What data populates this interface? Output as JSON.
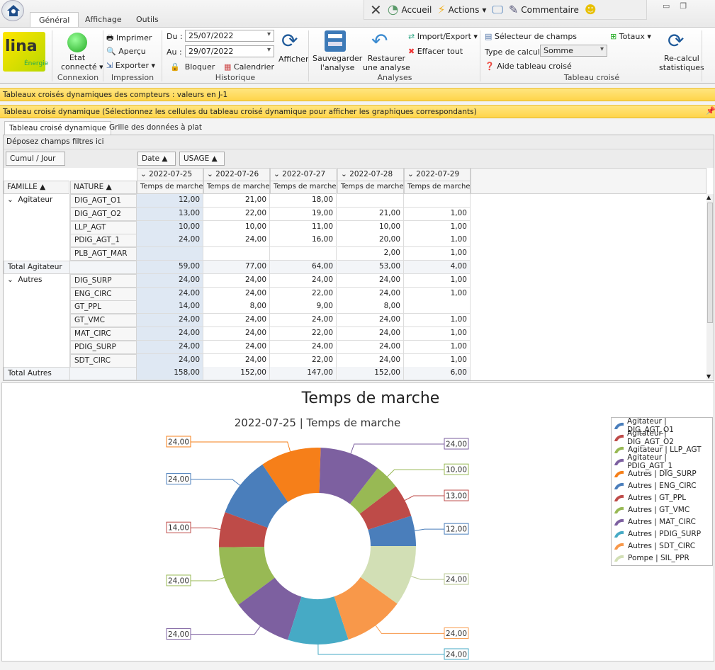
{
  "ribbon_tabs": [
    "Général",
    "Affichage",
    "Outils"
  ],
  "quick": {
    "accueil": "Accueil",
    "actions": "Actions",
    "commentaire": "Commentaire"
  },
  "logo": {
    "text": "lina",
    "sub": "Énergie"
  },
  "connexion": {
    "etat": "Etat",
    "connecte": "connecté ▾",
    "label": "Connexion"
  },
  "impression": {
    "imprimer": "Imprimer",
    "apercu": "Aperçu",
    "exporter": "Exporter ▾",
    "label": "Impression"
  },
  "historique": {
    "du_label": "Du :",
    "du": "25/07/2022",
    "au_label": "Au :",
    "au": "29/07/2022",
    "bloquer": "Bloquer",
    "calendrier": "Calendrier",
    "afficher": "Afficher",
    "label": "Historique"
  },
  "analyses": {
    "sauver1": "Sauvegarder",
    "sauver2": "l'analyse",
    "rest1": "Restaurer",
    "rest2": "une analyse",
    "import": "Import/Export ▾",
    "effacer": "Effacer tout",
    "label": "Analyses"
  },
  "tableau": {
    "selecteur": "Sélecteur de champs",
    "type_label": "Type de calcul :",
    "type": "Somme",
    "aide": "Aide tableau croisé",
    "totaux": "Totaux ▾",
    "recalc1": "Re-calcul",
    "recalc2": "statistiques",
    "label": "Tableau croisé"
  },
  "bar1": "Tableaux croisés dynamiques des compteurs : valeurs en J-1",
  "bar2": "Tableau croisé dynamique (Sélectionnez les cellules du tableau croisé dynamique pour afficher les graphiques correspondants)",
  "panel_tabs": [
    "Tableau croisé dynamique",
    "Grille des données à plat"
  ],
  "filter_zone": "Déposez champs filtres ici",
  "pivot": {
    "cumul": "Cumul / Jour",
    "date_btn": "Date ▲",
    "usage_btn": "USAGE ▲",
    "famille": "FAMILLE ▲",
    "nature": "NATURE ▲",
    "dates": [
      "2022-07-25",
      "2022-07-26",
      "2022-07-27",
      "2022-07-28",
      "2022-07-29"
    ],
    "measure": "Temps de marche",
    "rows": [
      {
        "famille": "Agitateur",
        "nature": "DIG_AGT_O1",
        "v": [
          "12,00",
          "21,00",
          "18,00",
          "",
          ""
        ]
      },
      {
        "famille": "",
        "nature": "DIG_AGT_O2",
        "v": [
          "13,00",
          "22,00",
          "19,00",
          "21,00",
          "1,00"
        ]
      },
      {
        "famille": "",
        "nature": "LLP_AGT",
        "v": [
          "10,00",
          "10,00",
          "11,00",
          "10,00",
          "1,00"
        ]
      },
      {
        "famille": "",
        "nature": "PDIG_AGT_1",
        "v": [
          "24,00",
          "24,00",
          "16,00",
          "20,00",
          "1,00"
        ]
      },
      {
        "famille": "",
        "nature": "PLB_AGT_MAR",
        "v": [
          "",
          "",
          "",
          "2,00",
          "1,00"
        ]
      },
      {
        "total": "Total Agitateur",
        "v": [
          "59,00",
          "77,00",
          "64,00",
          "53,00",
          "4,00"
        ]
      },
      {
        "famille": "Autres",
        "nature": "DIG_SURP",
        "v": [
          "24,00",
          "24,00",
          "24,00",
          "24,00",
          "1,00"
        ]
      },
      {
        "famille": "",
        "nature": "ENG_CIRC",
        "v": [
          "24,00",
          "24,00",
          "22,00",
          "24,00",
          "1,00"
        ]
      },
      {
        "famille": "",
        "nature": "GT_PPL",
        "v": [
          "14,00",
          "8,00",
          "9,00",
          "8,00",
          ""
        ]
      },
      {
        "famille": "",
        "nature": "GT_VMC",
        "v": [
          "24,00",
          "24,00",
          "24,00",
          "24,00",
          "1,00"
        ]
      },
      {
        "famille": "",
        "nature": "MAT_CIRC",
        "v": [
          "24,00",
          "24,00",
          "22,00",
          "24,00",
          "1,00"
        ]
      },
      {
        "famille": "",
        "nature": "PDIG_SURP",
        "v": [
          "24,00",
          "24,00",
          "24,00",
          "24,00",
          "1,00"
        ]
      },
      {
        "famille": "",
        "nature": "SDT_CIRC",
        "v": [
          "24,00",
          "24,00",
          "22,00",
          "24,00",
          "1,00"
        ]
      },
      {
        "total": "Total Autres",
        "v": [
          "158,00",
          "152,00",
          "147,00",
          "152,00",
          "6,00"
        ]
      }
    ]
  },
  "chart_data": {
    "type": "pie",
    "donut": true,
    "title": "Temps de marche",
    "subtitle": "2022-07-25 | Temps de marche",
    "legend_position": "right",
    "categories": [
      "Agitateur | DIG_AGT_O1",
      "Agitateur | DIG_AGT_O2",
      "Agitateur | LLP_AGT",
      "Agitateur | PDIG_AGT_1",
      "Autres | DIG_SURP",
      "Autres | ENG_CIRC",
      "Autres | GT_PPL",
      "Autres | GT_VMC",
      "Autres | MAT_CIRC",
      "Autres | PDIG_SURP",
      "Autres | SDT_CIRC",
      "Pompe | SIL_PPR"
    ],
    "values": [
      12,
      13,
      10,
      24,
      24,
      24,
      14,
      24,
      24,
      24,
      24,
      24
    ],
    "labels": [
      "12,00",
      "13,00",
      "10,00",
      "24,00",
      "24,00",
      "24,00",
      "14,00",
      "24,00",
      "24,00",
      "24,00",
      "24,00",
      "24,00"
    ],
    "colors": [
      "#4a7ebb",
      "#be4b48",
      "#98b954",
      "#7d60a0",
      "#f67f19",
      "#4a7ebb",
      "#be4b48",
      "#98b954",
      "#7d60a0",
      "#46aac5",
      "#f8984a",
      "#d2dfb5"
    ]
  }
}
